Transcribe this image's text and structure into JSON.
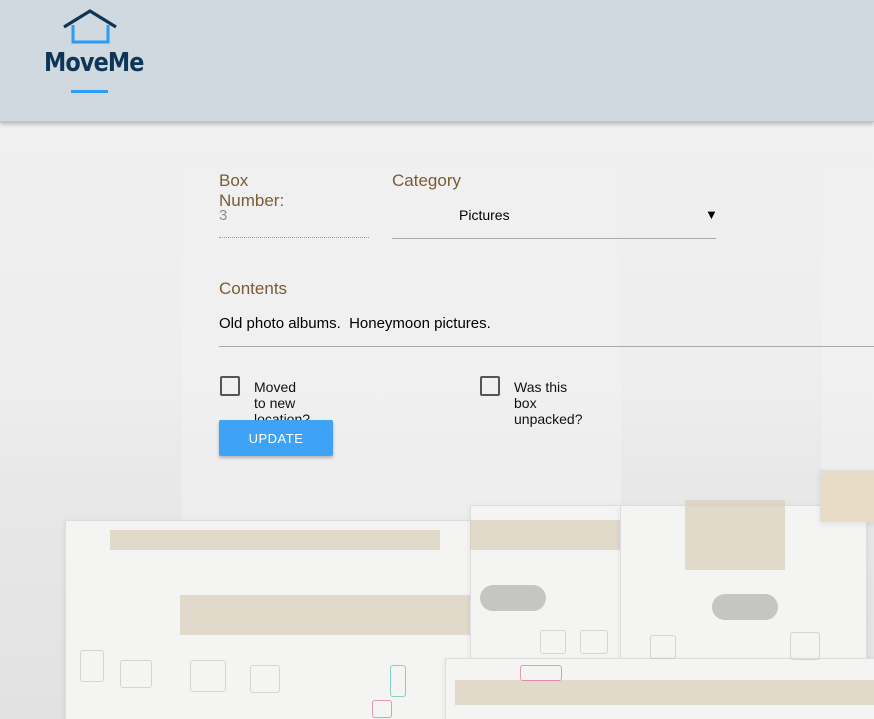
{
  "header": {
    "logo_text": "MoveMe"
  },
  "form": {
    "box_number": {
      "label": "Box Number:",
      "value": "3"
    },
    "category": {
      "label": "Category",
      "selected": "Pictures",
      "arrow": "▼"
    },
    "contents": {
      "label": "Contents",
      "value": "Old photo albums.  Honeymoon pictures."
    },
    "moved_checkbox": {
      "label": "Moved to new location?",
      "checked": false
    },
    "unpacked_checkbox": {
      "label": "Was this box unpacked?",
      "checked": false
    },
    "submit_label": "UPDATE"
  },
  "colors": {
    "header_bg": "#d0d9e0",
    "logo_navy": "#0e3558",
    "accent_blue": "#3ea3f6",
    "label_brown": "#7a5c34"
  },
  "icons": [
    "house-logo-icon",
    "dropdown-arrow-icon"
  ]
}
